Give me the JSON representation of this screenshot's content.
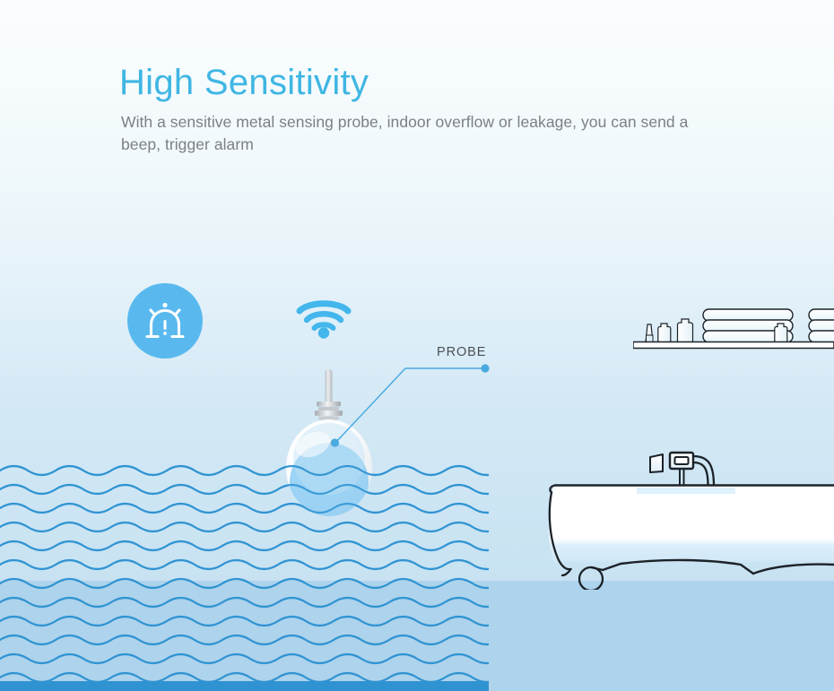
{
  "page": {
    "title": "High Sensitivity",
    "subtitle": "With a sensitive metal sensing probe, indoor overflow or leakage, you can send a beep, trigger alarm"
  },
  "colors": {
    "accent": "#3fb6e3",
    "badge": "#59b9ef",
    "wave_line": "#2f93d2",
    "wave_accent_bar": "#2f93d2",
    "water_fill": "#aed3ec",
    "subtitle_text": "#7c7f84",
    "label_text": "#4a4f55",
    "bg_top": "#fafdfe",
    "bg_bottom": "#c4e0f1",
    "led": "#d8a628"
  },
  "icons": {
    "alarm": "alarm-siren-icon",
    "wifi": "wifi-icon"
  },
  "annotation": {
    "probe_label": "PROBE"
  },
  "scene": {
    "device": "water-leak-sensor",
    "shelf_items": [
      "tube",
      "bottle-small",
      "bottle-tall",
      "towel-stack",
      "bottle-small",
      "towel-stack"
    ],
    "bathtub": "clawfoot-bathtub",
    "faucet": "bath-faucet"
  }
}
